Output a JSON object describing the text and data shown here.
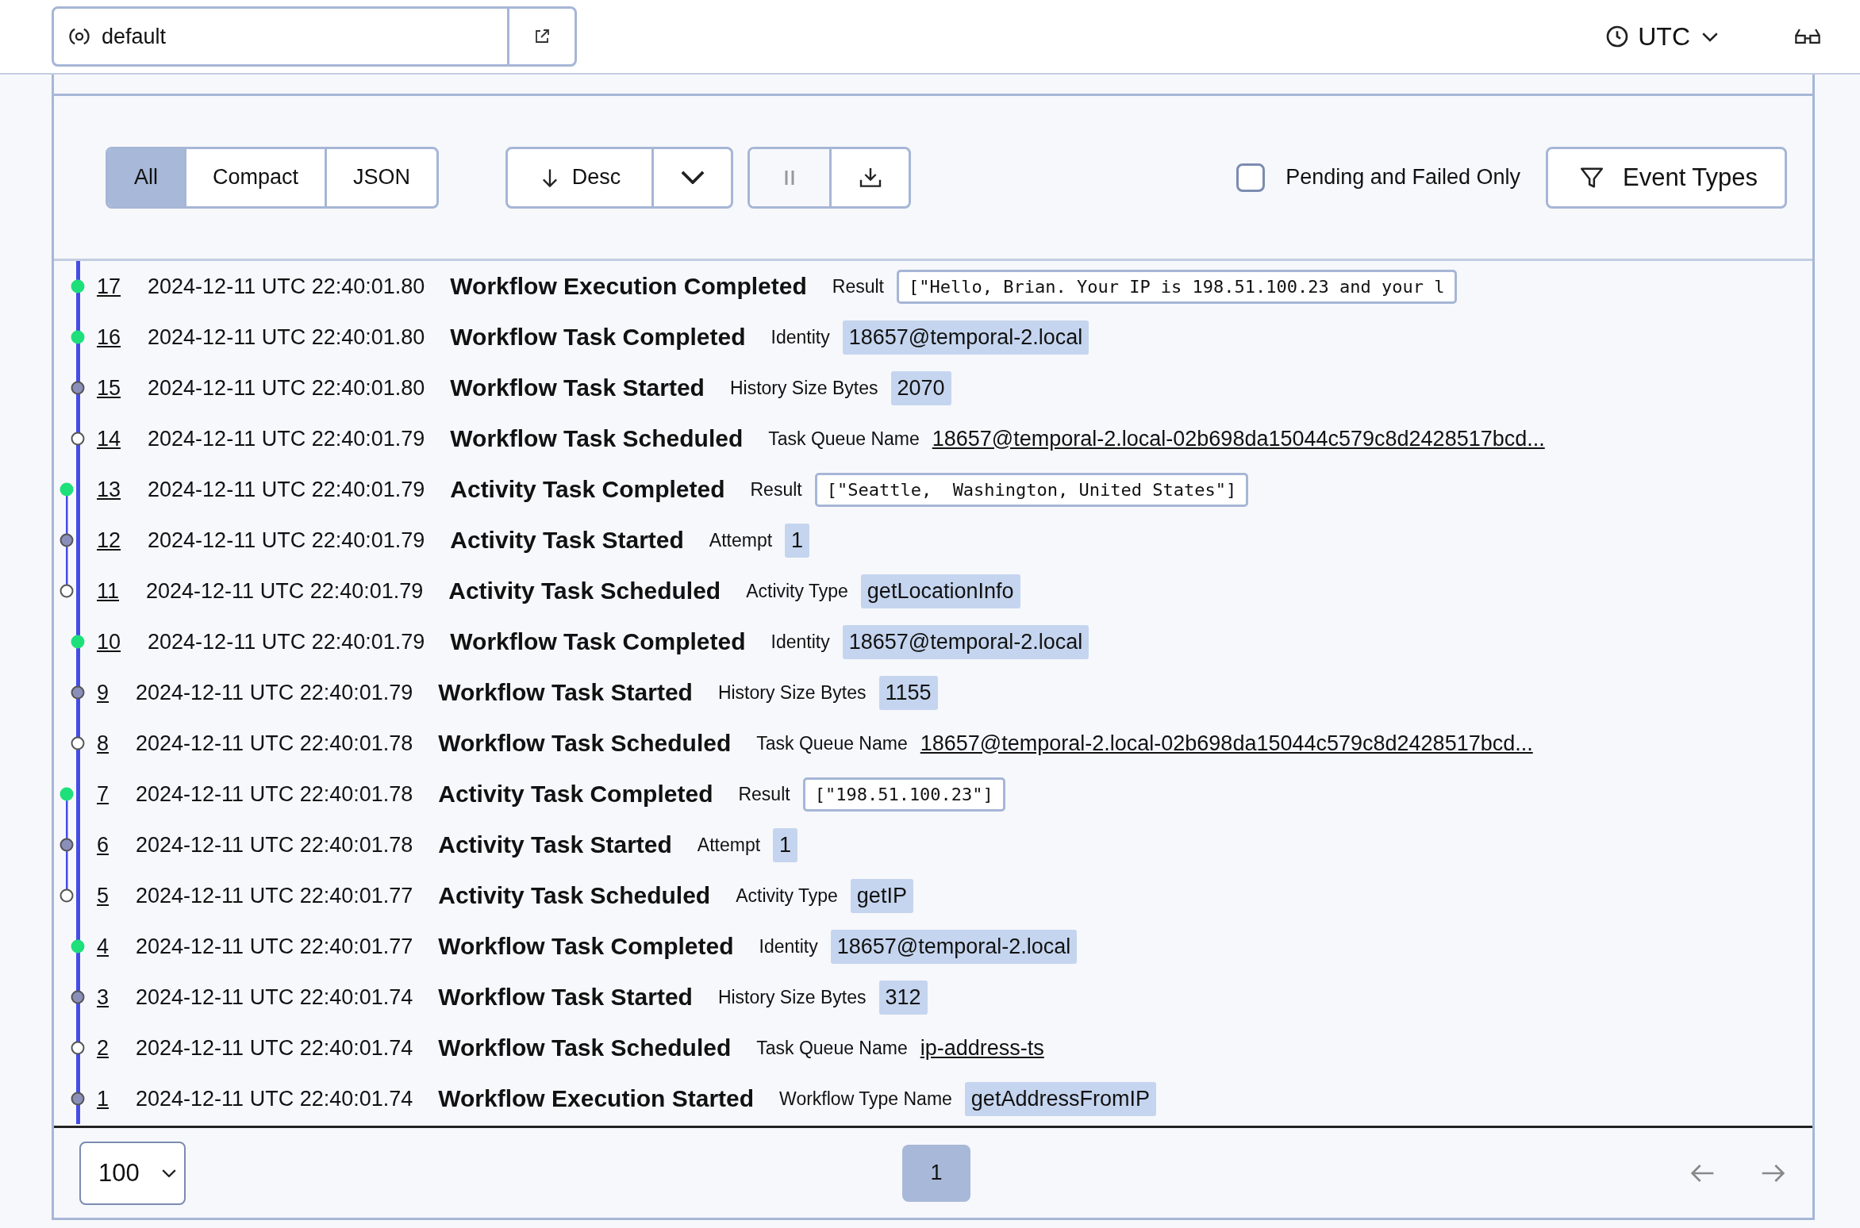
{
  "header": {
    "namespace": "default",
    "timezone": "UTC"
  },
  "toolbar": {
    "views": [
      {
        "label": "All",
        "selected": true
      },
      {
        "label": "Compact",
        "selected": false
      },
      {
        "label": "JSON",
        "selected": false
      }
    ],
    "sort": "Desc",
    "pending_filter": {
      "label": "Pending and Failed Only",
      "checked": false
    },
    "event_types": "Event Types"
  },
  "events": [
    {
      "id": "17",
      "time": "2024-12-11 UTC 22:40:01.80",
      "name": "Workflow Execution Completed",
      "kind": "completed",
      "activity": false,
      "detail": {
        "label": "Result",
        "value": "[\"Hello, Brian. Your IP is 198.51.100.23 and your l",
        "kind": "code"
      }
    },
    {
      "id": "16",
      "time": "2024-12-11 UTC 22:40:01.80",
      "name": "Workflow Task Completed",
      "kind": "completed",
      "activity": false,
      "detail": {
        "label": "Identity",
        "value": "18657@temporal-2.local",
        "kind": "badge"
      }
    },
    {
      "id": "15",
      "time": "2024-12-11 UTC 22:40:01.80",
      "name": "Workflow Task Started",
      "kind": "started",
      "activity": false,
      "detail": {
        "label": "History Size Bytes",
        "value": "2070",
        "kind": "badge"
      }
    },
    {
      "id": "14",
      "time": "2024-12-11 UTC 22:40:01.79",
      "name": "Workflow Task Scheduled",
      "kind": "scheduled",
      "activity": false,
      "detail": {
        "label": "Task Queue Name",
        "value": "18657@temporal-2.local-02b698da15044c579c8d2428517bcd...",
        "kind": "link"
      }
    },
    {
      "id": "13",
      "time": "2024-12-11 UTC 22:40:01.79",
      "name": "Activity Task Completed",
      "kind": "completed",
      "activity": true,
      "detail": {
        "label": "Result",
        "value": "[\"Seattle,  Washington, United States\"]",
        "kind": "code"
      }
    },
    {
      "id": "12",
      "time": "2024-12-11 UTC 22:40:01.79",
      "name": "Activity Task Started",
      "kind": "started",
      "activity": true,
      "detail": {
        "label": "Attempt",
        "value": "1",
        "kind": "badge"
      }
    },
    {
      "id": "11",
      "time": "2024-12-11 UTC 22:40:01.79",
      "name": "Activity Task Scheduled",
      "kind": "scheduled",
      "activity": true,
      "detail": {
        "label": "Activity Type",
        "value": "getLocationInfo",
        "kind": "badge"
      }
    },
    {
      "id": "10",
      "time": "2024-12-11 UTC 22:40:01.79",
      "name": "Workflow Task Completed",
      "kind": "completed",
      "activity": false,
      "detail": {
        "label": "Identity",
        "value": "18657@temporal-2.local",
        "kind": "badge"
      }
    },
    {
      "id": "9",
      "time": "2024-12-11 UTC 22:40:01.79",
      "name": "Workflow Task Started",
      "kind": "started",
      "activity": false,
      "detail": {
        "label": "History Size Bytes",
        "value": "1155",
        "kind": "badge"
      }
    },
    {
      "id": "8",
      "time": "2024-12-11 UTC 22:40:01.78",
      "name": "Workflow Task Scheduled",
      "kind": "scheduled",
      "activity": false,
      "detail": {
        "label": "Task Queue Name",
        "value": "18657@temporal-2.local-02b698da15044c579c8d2428517bcd...",
        "kind": "link"
      }
    },
    {
      "id": "7",
      "time": "2024-12-11 UTC 22:40:01.78",
      "name": "Activity Task Completed",
      "kind": "completed",
      "activity": true,
      "detail": {
        "label": "Result",
        "value": "[\"198.51.100.23\"]",
        "kind": "code"
      }
    },
    {
      "id": "6",
      "time": "2024-12-11 UTC 22:40:01.78",
      "name": "Activity Task Started",
      "kind": "started",
      "activity": true,
      "detail": {
        "label": "Attempt",
        "value": "1",
        "kind": "badge"
      }
    },
    {
      "id": "5",
      "time": "2024-12-11 UTC 22:40:01.77",
      "name": "Activity Task Scheduled",
      "kind": "scheduled",
      "activity": true,
      "detail": {
        "label": "Activity Type",
        "value": "getIP",
        "kind": "badge"
      }
    },
    {
      "id": "4",
      "time": "2024-12-11 UTC 22:40:01.77",
      "name": "Workflow Task Completed",
      "kind": "completed",
      "activity": false,
      "detail": {
        "label": "Identity",
        "value": "18657@temporal-2.local",
        "kind": "badge"
      }
    },
    {
      "id": "3",
      "time": "2024-12-11 UTC 22:40:01.74",
      "name": "Workflow Task Started",
      "kind": "started",
      "activity": false,
      "detail": {
        "label": "History Size Bytes",
        "value": "312",
        "kind": "badge"
      }
    },
    {
      "id": "2",
      "time": "2024-12-11 UTC 22:40:01.74",
      "name": "Workflow Task Scheduled",
      "kind": "scheduled",
      "activity": false,
      "detail": {
        "label": "Task Queue Name",
        "value": "ip-address-ts",
        "kind": "link"
      }
    },
    {
      "id": "1",
      "time": "2024-12-11 UTC 22:40:01.74",
      "name": "Workflow Execution Started",
      "kind": "started",
      "activity": false,
      "detail": {
        "label": "Workflow Type Name",
        "value": "getAddressFromIP",
        "kind": "badge"
      }
    }
  ],
  "pagination": {
    "page_size": "100",
    "pages": [
      {
        "label": "1",
        "selected": true
      }
    ]
  }
}
